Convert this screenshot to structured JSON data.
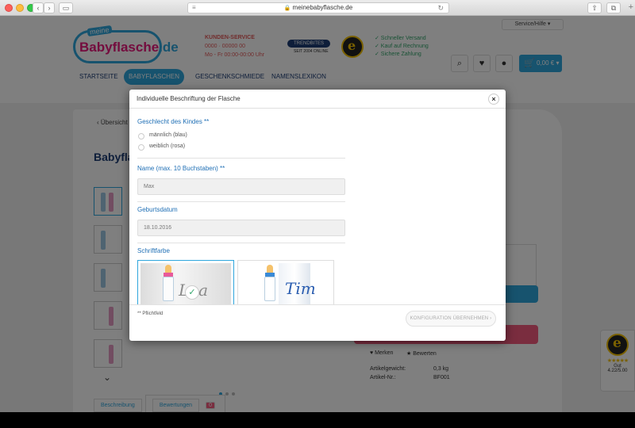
{
  "browser": {
    "url": "meinebabyflasche.de"
  },
  "site": {
    "logo_small": "meine",
    "logo_main": "Babyflasche",
    "logo_tld": ".de",
    "service_title": "KUNDEN-SERVICE",
    "service_phone": "0000 · 00000 00",
    "service_hours": "Mo - Fr 00:00-00:00 Uhr",
    "trust_name": "TRENDBITES",
    "trust_sub": "SEIT 2004 ONLINE",
    "checks": [
      "✓ Schneller Versand",
      "✓ Kauf auf Rechnung",
      "✓ Sichere Zahlung"
    ],
    "service_help": "Service/Hilfe ▾",
    "cart_total": "0,00 € ▾",
    "nav": [
      "STARTSEITE",
      "BABYFLASCHEN",
      "GESCHENKSCHMIEDE",
      "NAMENSLEXIKON"
    ],
    "breadcrumb": "‹ Übersicht",
    "product_title": "Babyflasche",
    "merken": "♥ Merken",
    "bewerten": "★ Bewerten",
    "spec_labels": [
      "Artikelgewicht:",
      "Artikel-Nr.:"
    ],
    "spec_values": [
      "0,3 kg",
      "BF001"
    ],
    "tab_beschreibung": "Beschreibung",
    "tab_bewertungen": "Bewertungen",
    "bewertungen_count": "0",
    "tw_grade": "Gut",
    "tw_score": "4.22/5.00",
    "tw_stars": "★★★★★"
  },
  "modal": {
    "title": "Individuelle Beschriftung der Flasche",
    "close": "×",
    "gender_label": "Geschlecht des Kindes **",
    "gender_options": [
      "männlich (blau)",
      "weiblich (rosa)"
    ],
    "name_label": "Name (max. 10 Buchstaben) **",
    "name_placeholder": "Max",
    "birth_label": "Geburtsdatum",
    "birth_placeholder": "18.10.2016",
    "font_color_label": "Schriftfarbe",
    "color_samples": [
      {
        "text": "Lea",
        "color": "#8a8a8a"
      },
      {
        "text": "Tim",
        "color": "#2a5db0"
      }
    ],
    "required_note": "** Pflichtfeld",
    "apply_button": "KONFIGURATION ÜBERNEHMEN ›"
  }
}
